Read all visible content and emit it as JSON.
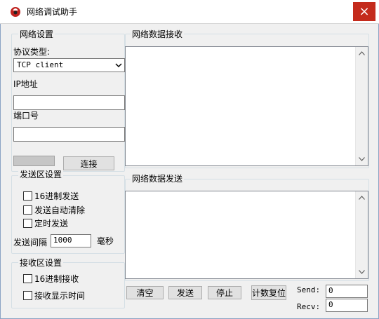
{
  "window": {
    "title": "网络调试助手",
    "close_glyph": "×"
  },
  "network": {
    "group_label": "网络设置",
    "protocol_label": "协议类型:",
    "protocol_value": "TCP client",
    "ip_label": "IP地址",
    "ip_value": "",
    "port_label": "端口号",
    "port_value": "",
    "connect_label": "连接"
  },
  "send_settings": {
    "group_label": "发送区设置",
    "hex_send_label": "16进制发送",
    "auto_clear_label": "发送自动清除",
    "timed_send_label": "定时发送",
    "interval_label": "发送间隔",
    "interval_value": "1000",
    "interval_unit": "毫秒"
  },
  "recv_settings": {
    "group_label": "接收区设置",
    "hex_recv_label": "16进制接收",
    "show_time_label": "接收显示时间"
  },
  "receive_area": {
    "group_label": "网络数据接收",
    "content": ""
  },
  "send_area": {
    "group_label": "网络数据发送",
    "content": ""
  },
  "actions": {
    "clear_label": "清空",
    "send_label": "发送",
    "stop_label": "停止",
    "reset_count_label": "计数复位"
  },
  "counters": {
    "send_label": "Send:",
    "send_value": "0",
    "recv_label": "Recv:",
    "recv_value": "0"
  }
}
